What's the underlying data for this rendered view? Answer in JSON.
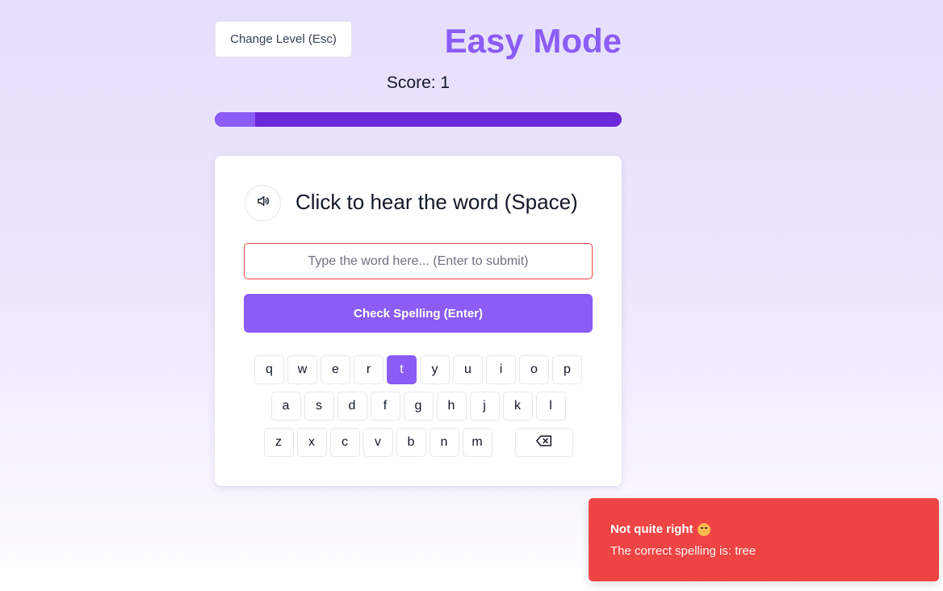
{
  "header": {
    "change_level_label": "Change Level (Esc)",
    "mode_title": "Easy Mode"
  },
  "score": {
    "label": "Score: 1",
    "value": 1
  },
  "progress": {
    "fraction": 0.1,
    "fill_color": "#8b5cf6",
    "track_color": "#6d28d9"
  },
  "card": {
    "speaker_icon": "speaker-icon",
    "hear_label": "Click to hear the word (Space)",
    "input_placeholder": "Type the word here... (Enter to submit)",
    "input_value": "",
    "check_label": "Check Spelling (Enter)"
  },
  "keyboard": {
    "row1": [
      "q",
      "w",
      "e",
      "r",
      "t",
      "y",
      "u",
      "i",
      "o",
      "p"
    ],
    "row2": [
      "a",
      "s",
      "d",
      "f",
      "g",
      "h",
      "j",
      "k",
      "l"
    ],
    "row3": [
      "z",
      "x",
      "c",
      "v",
      "b",
      "n",
      "m"
    ],
    "active_key": "t",
    "backspace_icon": "backspace-icon"
  },
  "toast": {
    "title": "Not quite right",
    "emoji_icon": "smiling-emoji-icon",
    "message": "The correct spelling is: tree",
    "color": "#ef4444"
  },
  "colors": {
    "accent": "#8b5cf6",
    "error": "#ef4444"
  }
}
